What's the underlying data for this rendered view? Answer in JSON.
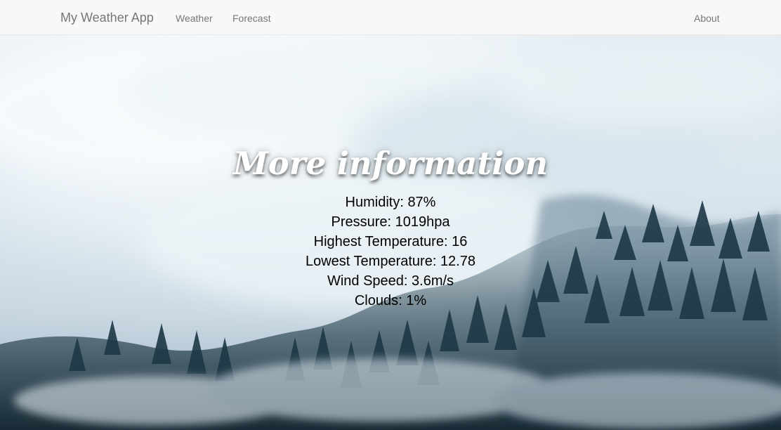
{
  "nav": {
    "brand": "My Weather App",
    "links": [
      {
        "label": "Weather"
      },
      {
        "label": "Forecast"
      },
      {
        "label": "About"
      }
    ]
  },
  "main": {
    "title": "More information",
    "details": [
      "Humidity: 87%",
      "Pressure: 1019hpa",
      "Highest Temperature: 16",
      "Lowest Temperature: 12.78",
      "Wind Speed: 3.6m/s",
      "Clouds: 1%"
    ]
  },
  "colors": {
    "navbar_bg": "#f8f8f8",
    "nav_text": "#777777",
    "title_text": "#ffffff",
    "info_text": "#000000",
    "forest_dark": "#223d4a",
    "mist": "#dfe8ef"
  }
}
